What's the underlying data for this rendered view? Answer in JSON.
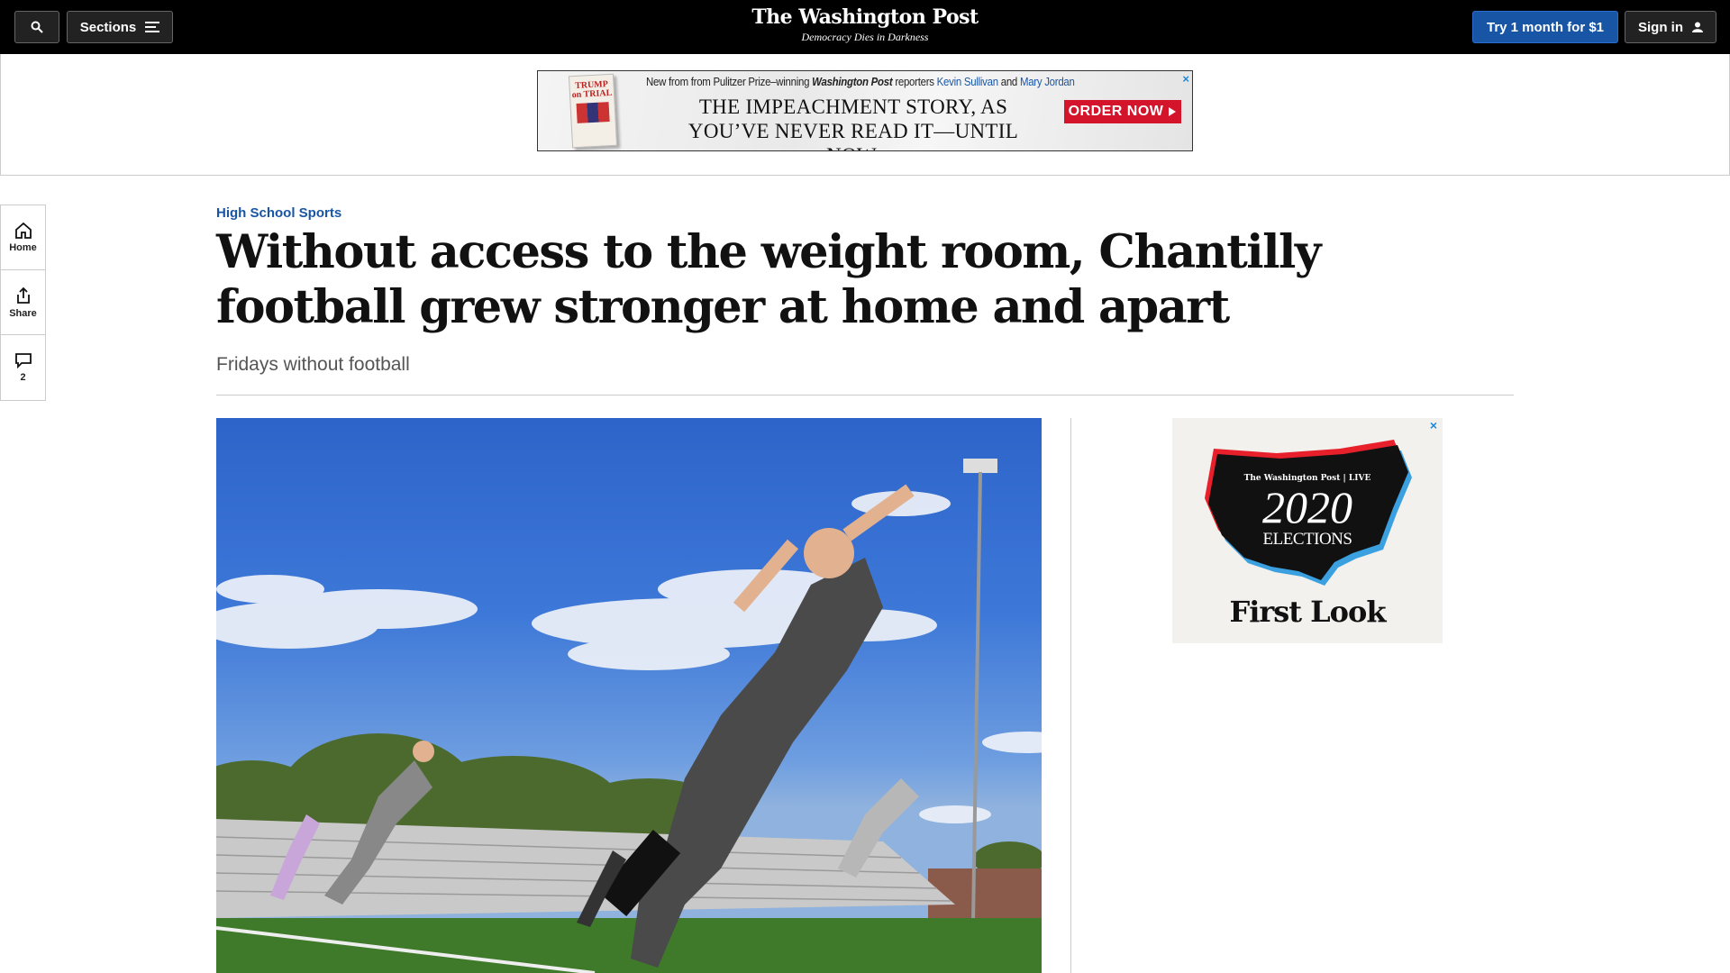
{
  "nav": {
    "sections_label": "Sections",
    "logo": "The Washington Post",
    "tagline": "Democracy Dies in Darkness",
    "trial_label": "Try 1 month for $1",
    "signin_label": "Sign in"
  },
  "banner_ad": {
    "book_title": "TRUMP on TRIAL",
    "intro": "New from from Pulitzer Prize–winning",
    "publication": "Washington Post",
    "reporters_word": "reporters",
    "author1": "Kevin Sullivan",
    "and_word": "and",
    "author2": "Mary Jordan",
    "main_line1": "THE IMPEACHMENT STORY, AS",
    "main_line2": "YOU’VE NEVER READ IT—UNTIL NOW.",
    "cta": "ORDER NOW",
    "close": "×"
  },
  "rail": {
    "home_label": "Home",
    "share_label": "Share",
    "comments_count": "2"
  },
  "article": {
    "kicker": "High School Sports",
    "headline": "Without access to the weight room, Chantilly football grew stronger at home and apart",
    "subhead": "Fridays without football"
  },
  "side_ad": {
    "close": "×",
    "brand": "The Washington Post | LIVE",
    "year": "2020",
    "title": "ELECTIONS",
    "tagline": "First Look"
  },
  "colors": {
    "brand_blue": "#1955a5",
    "ad_red": "#d4142a",
    "nav_black": "#000000"
  }
}
